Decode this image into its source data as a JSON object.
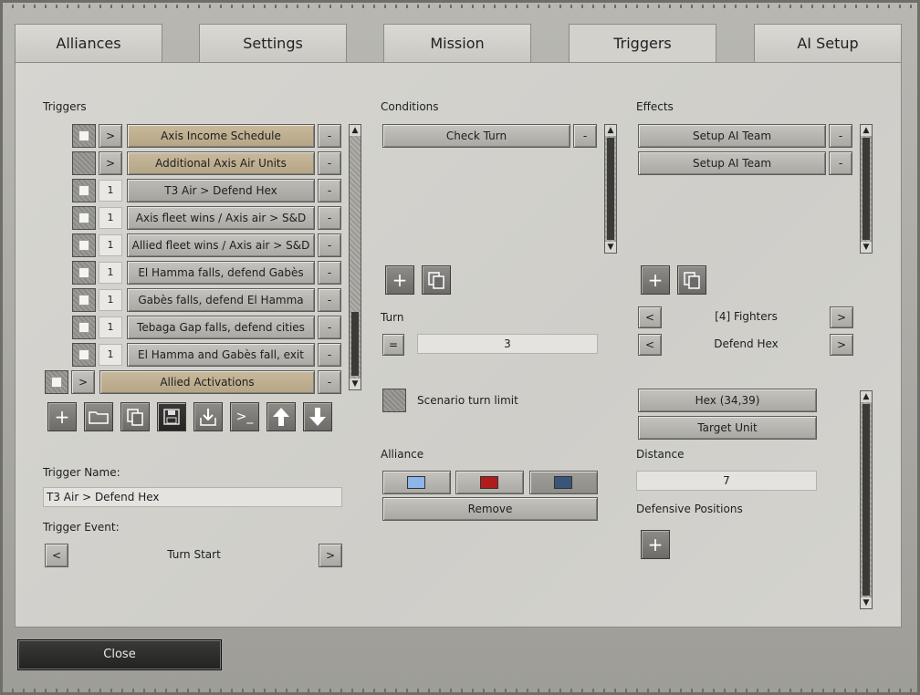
{
  "tabs": [
    "Alliances",
    "Settings",
    "Mission",
    "Triggers",
    "AI Setup"
  ],
  "triggers": {
    "heading": "Triggers",
    "rows": [
      {
        "marker": ">",
        "label": "Axis Income Schedule",
        "remove": "-"
      },
      {
        "marker": ">",
        "label": "Additional Axis Air Units",
        "remove": "-"
      },
      {
        "marker": "1",
        "label": "T3 Air > Defend Hex",
        "remove": "-"
      },
      {
        "marker": "1",
        "label": "Axis fleet wins / Axis air > S&D",
        "remove": "-"
      },
      {
        "marker": "1",
        "label": "Allied fleet wins / Axis air > S&D",
        "remove": "-"
      },
      {
        "marker": "1",
        "label": "El Hamma falls, defend Gabès",
        "remove": "-"
      },
      {
        "marker": "1",
        "label": "Gabès falls, defend El Hamma",
        "remove": "-"
      },
      {
        "marker": "1",
        "label": "Tebaga Gap falls, defend cities",
        "remove": "-"
      },
      {
        "marker": "1",
        "label": "El Hamma and Gabès fall, exit",
        "remove": "-"
      },
      {
        "marker": ">",
        "label": "Allied Activations",
        "remove": "-"
      }
    ],
    "toolbar_icons": [
      "plus-icon",
      "folder-icon",
      "copy-icon",
      "save-icon",
      "import-icon",
      "console-icon",
      "arrow-up-icon",
      "arrow-down-icon"
    ],
    "trigger_name_label": "Trigger Name:",
    "trigger_name_value": "T3 Air > Defend Hex",
    "trigger_event_label": "Trigger Event:",
    "trigger_event_value": "Turn Start",
    "prev": "<",
    "next": ">"
  },
  "conditions": {
    "heading": "Conditions",
    "items": [
      {
        "label": "Check Turn",
        "remove": "-"
      }
    ],
    "turn_label": "Turn",
    "turn_operator": "=",
    "turn_value": "3",
    "scenario_limit_label": "Scenario turn limit",
    "alliance_label": "Alliance",
    "remove_label": "Remove"
  },
  "effects": {
    "heading": "Effects",
    "items": [
      {
        "label": "Setup AI Team",
        "remove": "-"
      },
      {
        "label": "Setup AI Team",
        "remove": "-"
      }
    ],
    "fighters_label": "[4] Fighters",
    "order_label": "Defend Hex",
    "prev": "<",
    "next": ">",
    "hex_label": "Hex (34,39)",
    "target_unit_label": "Target Unit",
    "distance_label": "Distance",
    "distance_value": "7",
    "defensive_positions_label": "Defensive Positions"
  },
  "colors": {
    "alliance_light_blue": "#8fb4ea",
    "alliance_red": "#b01c1c",
    "alliance_navy": "#3b557a"
  },
  "close_label": "Close"
}
